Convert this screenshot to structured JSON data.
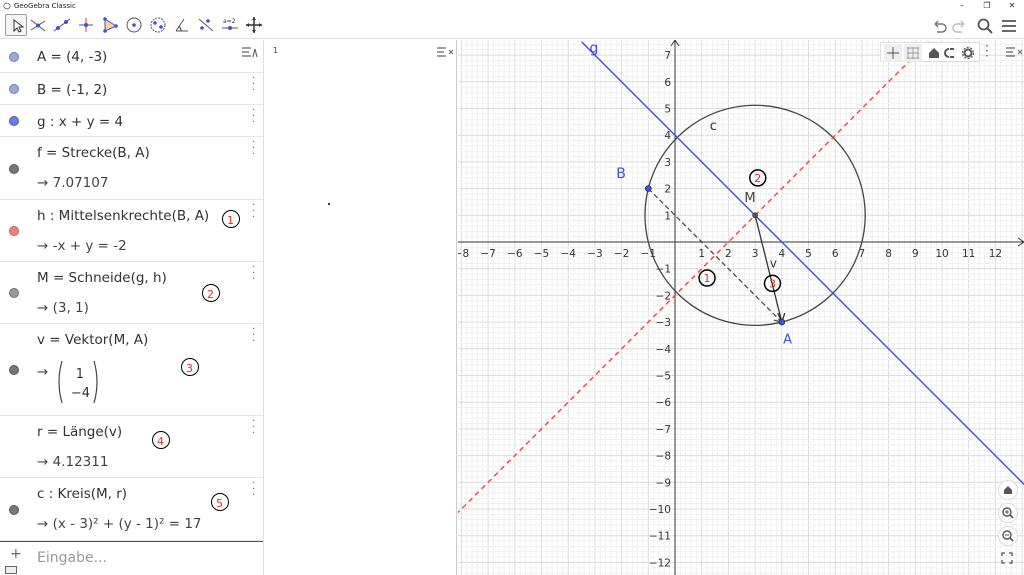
{
  "window": {
    "title": "GeoGebra Classic"
  },
  "algebra": {
    "rows": [
      {
        "def": "A = (4, -3)",
        "val": "",
        "color": "#9fa8da",
        "tag": ""
      },
      {
        "def": "B = (-1, 2)",
        "val": "",
        "color": "#9fa8da",
        "tag": ""
      },
      {
        "def": "g : x + y = 4",
        "val": "",
        "color": "#6b7ce6",
        "tag": ""
      },
      {
        "def": "f = Strecke(B, A)",
        "val": "→ 7.07107",
        "color": "#777777",
        "tag": ""
      },
      {
        "def": "h : Mittelsenkrechte(B, A)",
        "val": "→ -x + y = -2",
        "color": "#f08080",
        "tag": "1"
      },
      {
        "def": "M = Schneide(g, h)",
        "val": "→ (3, 1)",
        "color": "#999999",
        "tag": "2"
      },
      {
        "def": "v = Vektor(M, A)",
        "val": "→",
        "vec_top": "1",
        "vec_bottom": "−4",
        "color": "#777777",
        "tag": "3"
      },
      {
        "def": "r = Länge(v)",
        "val": "→ 4.12311",
        "color": "",
        "tag": "4"
      },
      {
        "def": "c : Kreis(M, r)",
        "val": "→ (x - 3)² + (y - 1)² = 17",
        "color": "#777777",
        "tag": "5"
      }
    ],
    "input_placeholder": "Eingabe..."
  },
  "spreadsheet": {
    "row1": "1"
  },
  "graphics": {
    "origin": {
      "x": 3,
      "y": 1
    },
    "x_ticks": [
      "−8",
      "−7",
      "−6",
      "−5",
      "−4",
      "−3",
      "−2",
      "−1",
      "1",
      "2",
      "3",
      "4",
      "5",
      "6",
      "7",
      "8",
      "9",
      "10",
      "11",
      "12"
    ],
    "y_ticks": [
      "7",
      "6",
      "5",
      "4",
      "3",
      "2",
      "1",
      "−1",
      "−2",
      "−3",
      "−4",
      "−5",
      "−6",
      "−7",
      "−8",
      "−9",
      "−10",
      "−11",
      "−12"
    ],
    "labels": {
      "g": "g",
      "c": "c",
      "B": "B",
      "M": "M",
      "A": "A",
      "v": "v"
    },
    "markers": [
      "1",
      "2",
      "3"
    ],
    "colors": {
      "line_g": "#3f51d9",
      "line_h": "#f44336",
      "circle": "#444444",
      "points": "#3f51d9",
      "grid": "#e6e6e6"
    }
  }
}
